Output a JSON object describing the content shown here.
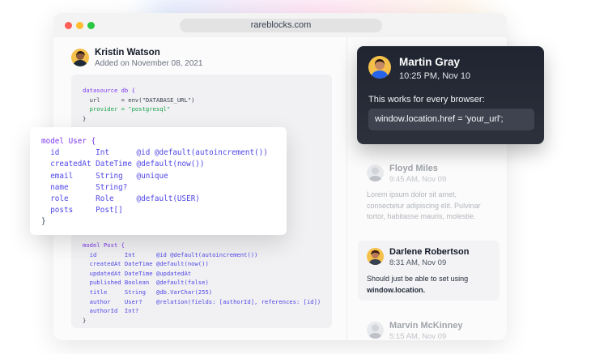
{
  "browser": {
    "url": "rareblocks.com"
  },
  "post": {
    "author_name": "Kristin Watson",
    "added_on": "Added on November 08, 2021"
  },
  "code": {
    "datasource": [
      "datasource db {",
      "  url      = env(\"DATABASE_URL\")",
      "  provider = \"postgresql\"",
      "}"
    ],
    "user_model": [
      "model User {",
      "  id        Int      @id @default(autoincrement())",
      "  createdAt DateTime @default(now())",
      "  email     String   @unique",
      "  name      String?",
      "  role      Role     @default(USER)",
      "  posts     Post[]",
      "}"
    ],
    "post_model": [
      "model Post {",
      "  id        Int      @id @default(autoincrement())",
      "  createdAt DateTime @default(now())",
      "  updatedAt DateTime @updatedAt",
      "  published Boolean  @default(false)",
      "  title     String   @db.VarChar(255)",
      "  author    User?    @relation(fields: [authorId], references: [id])",
      "  authorId  Int?",
      "}"
    ]
  },
  "comments": [
    {
      "name": "Martin Gray",
      "time": "10:25 PM, Nov 10",
      "message": "This works for every browser:",
      "code": "window.location.href = 'your_url';"
    },
    {
      "name": "Floyd Miles",
      "time": "9:45 AM, Nov 09",
      "message": "Lorem ipsum dolor sit amet, consectetur adipiscing elit. Pulvinar tortor, habitasse mauris, molestie."
    },
    {
      "name": "Darlene Robertson",
      "time": "8:31 AM, Nov 09",
      "message_prefix": "Should just be able to set using",
      "message_code": "window.location."
    },
    {
      "name": "Marvin McKinney",
      "time": "5:15 AM, Nov 09"
    }
  ],
  "colors": {
    "accent_dark_card": "#1f2430",
    "keyword": "#7c3aed",
    "string": "#16a34a"
  }
}
